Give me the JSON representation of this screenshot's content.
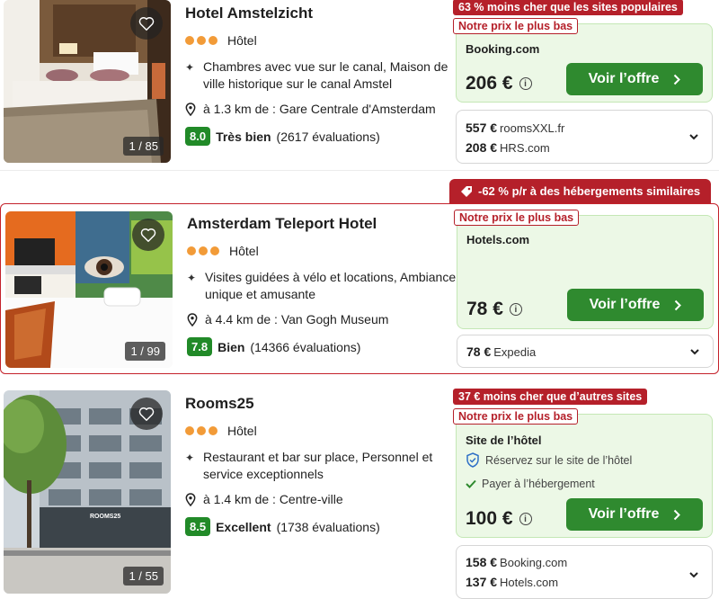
{
  "hotels": [
    {
      "name": "Hotel Amstelzicht",
      "type": "Hôtel",
      "feature": "Chambres avec vue sur le canal, Maison de ville historique sur le canal Amstel",
      "distance": "à 1.3 km de : Gare Centrale d'Amsterdam",
      "score": "8.0",
      "rating_word": "Très bien",
      "reviews": "(2617 évaluations)",
      "photo_counter": "1 / 85",
      "deal_badge": "63 % moins cher que les sites populaires",
      "best_price_badge": "Notre prix le plus bas",
      "provider": "Booking.com",
      "price": "206 €",
      "cta": "Voir l’offre",
      "other_offers": [
        {
          "price": "557 €",
          "site": "roomsXXL.fr"
        },
        {
          "price": "208 €",
          "site": "HRS.com"
        }
      ]
    },
    {
      "name": "Amsterdam Teleport Hotel",
      "type": "Hôtel",
      "feature": "Visites guidées à vélo et locations, Ambiance unique et amusante",
      "distance": "à 4.4 km de : Van Gogh Museum",
      "score": "7.8",
      "rating_word": "Bien",
      "reviews": "(14366 évaluations)",
      "photo_counter": "1 / 99",
      "deal_badge": "-62 % p/r à des hébergements similaires",
      "best_price_badge": "Notre prix le plus bas",
      "provider": "Hotels.com",
      "price": "78 €",
      "cta": "Voir l’offre",
      "other_offers": [
        {
          "price": "78 €",
          "site": "Expedia"
        }
      ]
    },
    {
      "name": "Rooms25",
      "type": "Hôtel",
      "feature": "Restaurant et bar sur place, Personnel et service exceptionnels",
      "distance": "à 1.4 km de : Centre-ville",
      "score": "8.5",
      "rating_word": "Excellent",
      "reviews": "(1738 évaluations)",
      "photo_counter": "1 / 55",
      "building_sign": "ROOMS25",
      "deal_badge": "37 € moins cher que d’autres sites",
      "best_price_badge": "Notre prix le plus bas",
      "provider": "Site de l’hôtel",
      "perk_1": "Réservez sur le site de l’hôtel",
      "perk_2": "Payer à l’hébergement",
      "price": "100 €",
      "cta": "Voir l’offre",
      "other_offers": [
        {
          "price": "158 €",
          "site": "Booking.com"
        },
        {
          "price": "137 €",
          "site": "Hotels.com"
        }
      ]
    }
  ],
  "colors": {
    "accent_green": "#2f8a2f",
    "deal_red": "#b5202a",
    "score_green": "#218a28",
    "star_orange": "#f29b38",
    "offer_bg": "#ecf8e6"
  },
  "icons": {
    "favorite": "heart-outline-icon",
    "feature": "sparkle-icon",
    "distance": "map-pin-icon",
    "deal": "price-tag-icon",
    "expand": "chevron-down-icon",
    "cta": "chevron-right-icon",
    "verified": "shield-check-icon",
    "pay": "check-icon",
    "price_info": "info-icon"
  }
}
